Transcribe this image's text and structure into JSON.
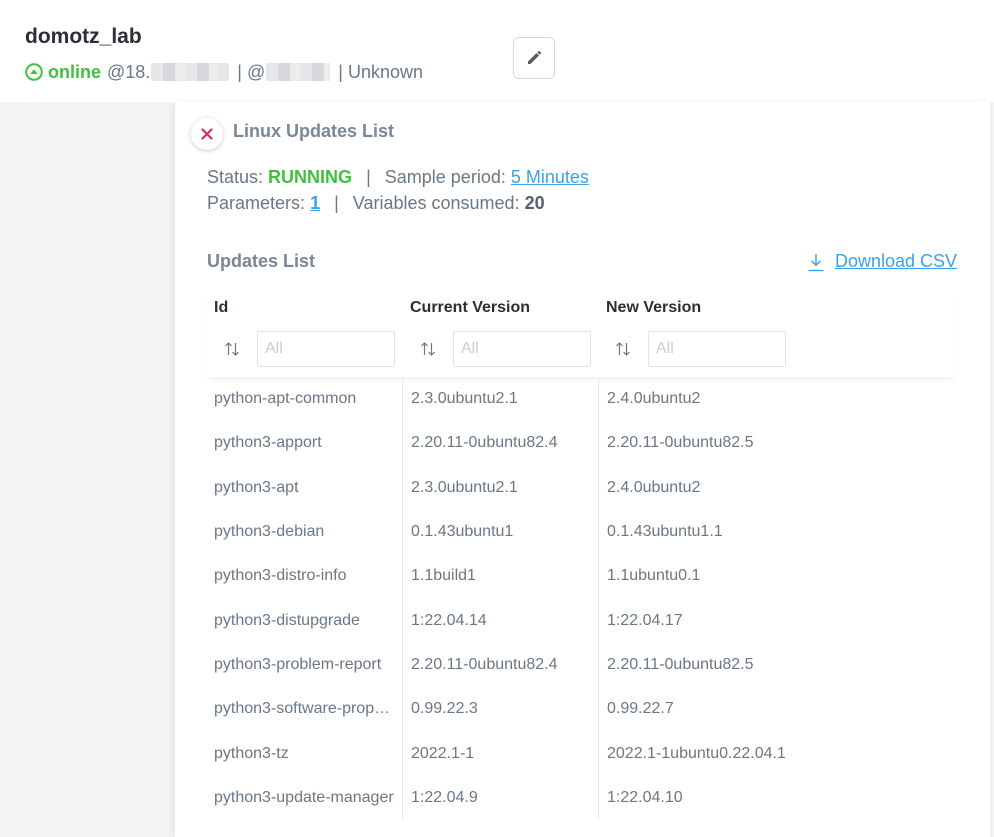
{
  "device": {
    "name": "domotz_lab",
    "status": "online",
    "ip_prefix": "@18.",
    "at_sign": "@",
    "separator": "|",
    "vendor": "Unknown"
  },
  "panel": {
    "title": "Linux Updates List",
    "status_label": "Status:",
    "status_value": "RUNNING",
    "sample_period_label": "Sample period:",
    "sample_period_value": "5 Minutes",
    "parameters_label": "Parameters:",
    "parameters_value": "1",
    "variables_label": "Variables consumed:",
    "variables_value": "20",
    "separator": "|",
    "section_title": "Updates List",
    "download_label": "Download CSV"
  },
  "table": {
    "columns": [
      "Id",
      "Current Version",
      "New Version"
    ],
    "filter_placeholder": "All",
    "rows": [
      [
        "python-apt-common",
        "2.3.0ubuntu2.1",
        "2.4.0ubuntu2"
      ],
      [
        "python3-apport",
        "2.20.11-0ubuntu82.4",
        "2.20.11-0ubuntu82.5"
      ],
      [
        "python3-apt",
        "2.3.0ubuntu2.1",
        "2.4.0ubuntu2"
      ],
      [
        "python3-debian",
        "0.1.43ubuntu1",
        "0.1.43ubuntu1.1"
      ],
      [
        "python3-distro-info",
        "1.1build1",
        "1.1ubuntu0.1"
      ],
      [
        "python3-distupgrade",
        "1:22.04.14",
        "1:22.04.17"
      ],
      [
        "python3-problem-report",
        "2.20.11-0ubuntu82.4",
        "2.20.11-0ubuntu82.5"
      ],
      [
        "python3-software-prop…",
        "0.99.22.3",
        "0.99.22.7"
      ],
      [
        "python3-tz",
        "2022.1-1",
        "2022.1-1ubuntu0.22.04.1"
      ],
      [
        "python3-update-manager",
        "1:22.04.9",
        "1:22.04.10"
      ]
    ]
  },
  "colors": {
    "online": "#3ec13e",
    "link": "#3aa2e8",
    "close": "#d0315f"
  }
}
